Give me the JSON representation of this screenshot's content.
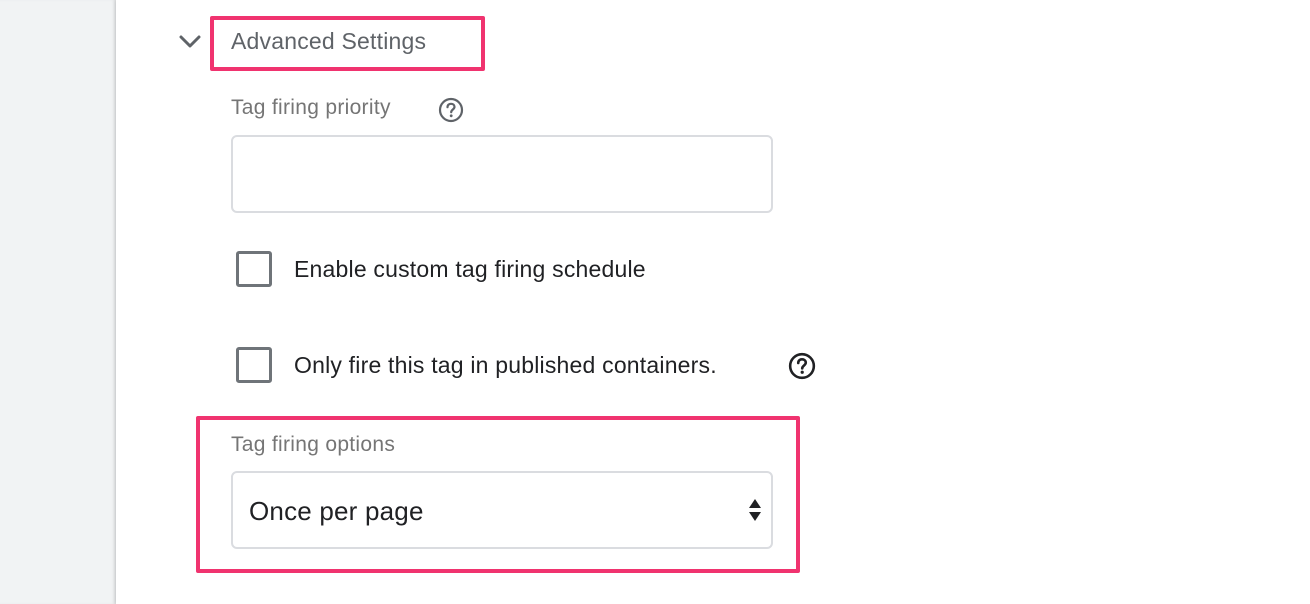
{
  "section": {
    "title": "Advanced Settings",
    "expanded": true,
    "toggle_icon": "chevron-down-icon"
  },
  "priority": {
    "label": "Tag firing priority",
    "value": "",
    "help_icon": "help-circle-icon"
  },
  "checkboxes": [
    {
      "label": "Enable custom tag firing schedule",
      "checked": false
    },
    {
      "label": "Only fire this tag in published containers.",
      "checked": false,
      "help_icon": "help-circle-icon"
    }
  ],
  "firing_options": {
    "label": "Tag firing options",
    "selected": "Once per page",
    "icon": "select-arrows-icon"
  },
  "colors": {
    "highlight": "#f0336f",
    "label_gray": "#757575",
    "text_dark": "#202124",
    "rail_bg": "#f1f3f4"
  }
}
